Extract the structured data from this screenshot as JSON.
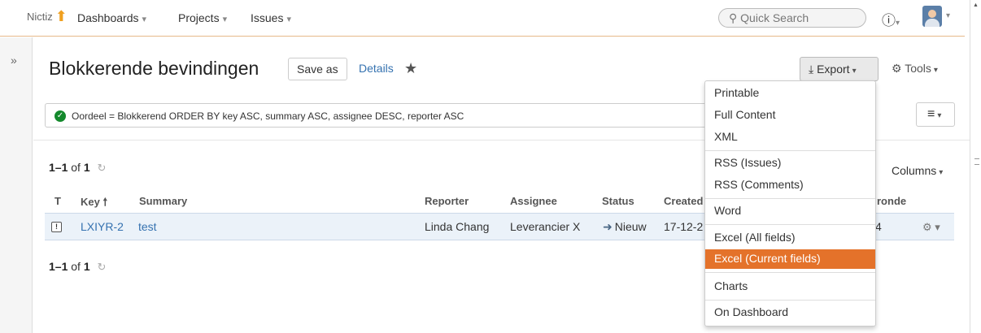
{
  "header": {
    "logo_text": "Nictiz",
    "nav": [
      {
        "label": "Dashboards"
      },
      {
        "label": "Projects"
      },
      {
        "label": "Issues"
      }
    ],
    "search_placeholder": "Quick Search",
    "caret": "▾"
  },
  "page": {
    "title": "Blokkerende bevindingen",
    "save_as": "Save as",
    "details": "Details",
    "export": "Export",
    "tools": "Tools"
  },
  "query": {
    "text": "Oordeel = Blokkerend ORDER BY key ASC, summary ASC, assignee DESC, reporter ASC"
  },
  "results": {
    "count_range": "1–1",
    "count_of": "of",
    "count_total": "1",
    "columns_label": "Columns"
  },
  "table": {
    "headers": {
      "t": "T",
      "key": "Key",
      "summary": "Summary",
      "reporter": "Reporter",
      "assignee": "Assignee",
      "status": "Status",
      "created": "Created",
      "extra": "ronde"
    },
    "rows": [
      {
        "key": "LXIYR-2",
        "summary": "test",
        "reporter": "Linda Chang",
        "assignee": "Leverancier X",
        "status": "Nieuw",
        "created": "17-12-2",
        "extra": "4"
      }
    ]
  },
  "export_menu": {
    "items": [
      {
        "label": "Printable"
      },
      {
        "label": "Full Content"
      },
      {
        "label": "XML"
      },
      {
        "label": "RSS (Issues)"
      },
      {
        "label": "RSS (Comments)"
      },
      {
        "label": "Word"
      },
      {
        "label": "Excel (All fields)"
      },
      {
        "label": "Excel (Current fields)",
        "highlighted": true
      },
      {
        "label": "Charts"
      },
      {
        "label": "On Dashboard"
      }
    ]
  },
  "colors": {
    "accent_orange": "#e4722a",
    "link_blue": "#3572b0",
    "success_green": "#14892c"
  }
}
